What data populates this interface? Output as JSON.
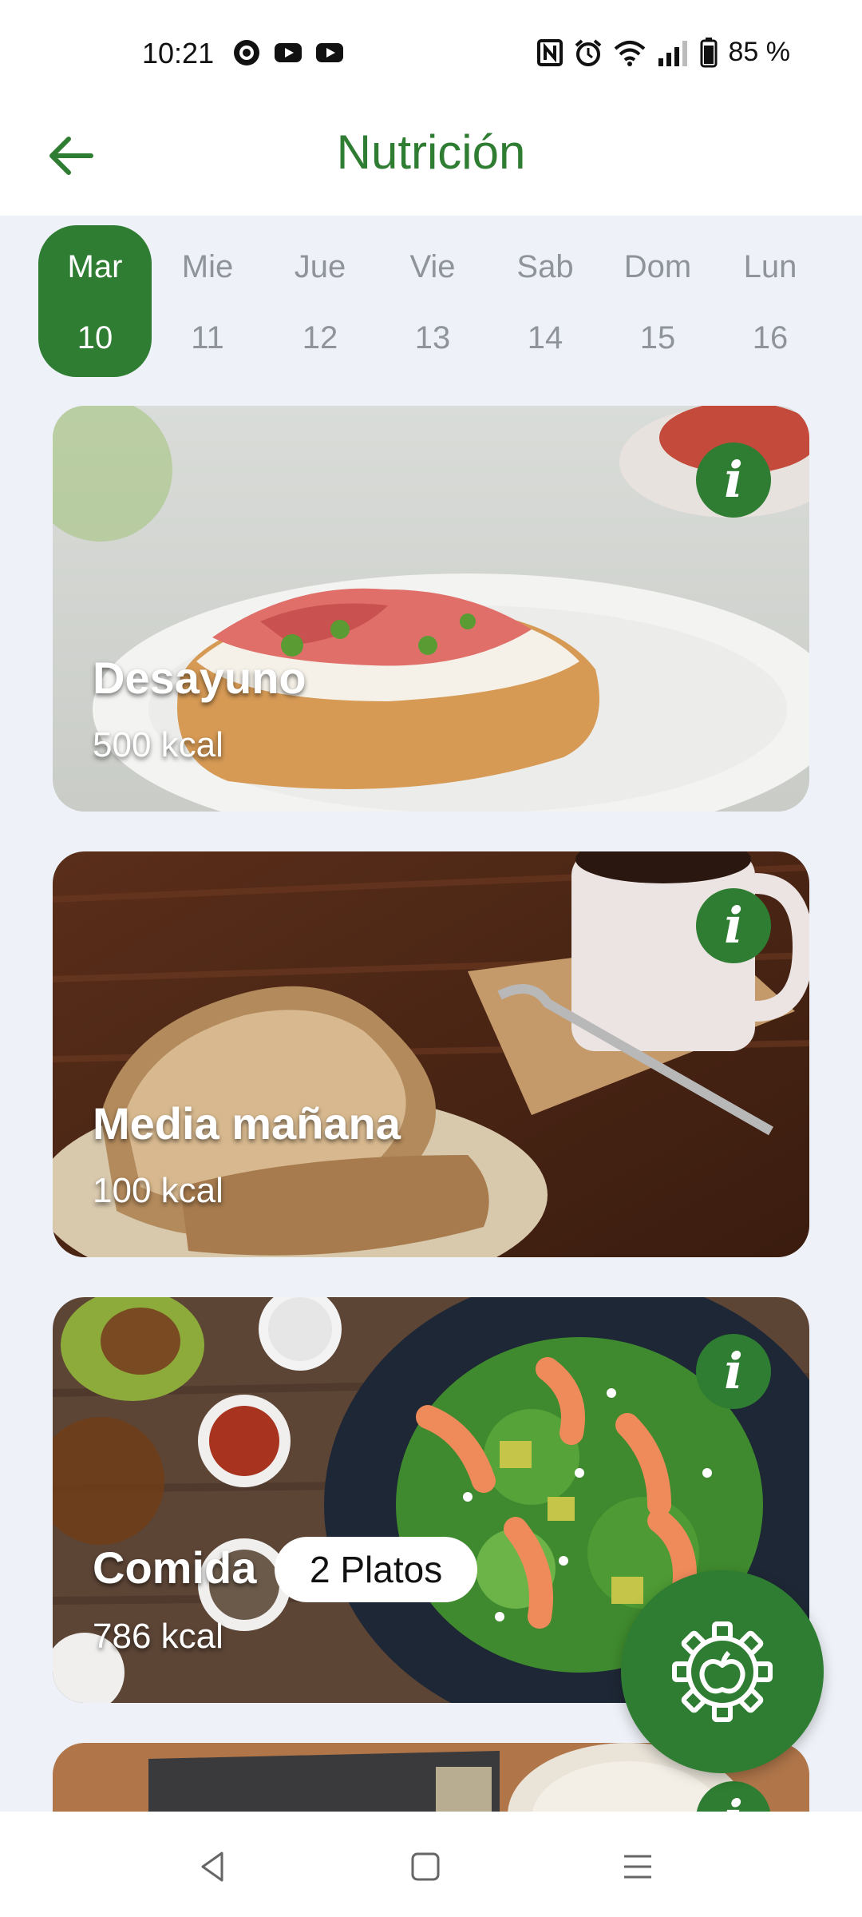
{
  "status_bar": {
    "time": "10:21",
    "battery": "85 %",
    "icons": [
      "record-icon",
      "youtube-icon",
      "youtube-icon",
      "nfc-icon",
      "alarm-icon",
      "wifi-icon",
      "signal-icon",
      "battery-icon"
    ]
  },
  "header": {
    "title": "Nutrición",
    "back_icon": "arrow-left-icon"
  },
  "days": [
    {
      "name": "Mar",
      "num": "10",
      "active": true
    },
    {
      "name": "Mie",
      "num": "11",
      "active": false
    },
    {
      "name": "Jue",
      "num": "12",
      "active": false
    },
    {
      "name": "Vie",
      "num": "13",
      "active": false
    },
    {
      "name": "Sab",
      "num": "14",
      "active": false
    },
    {
      "name": "Dom",
      "num": "15",
      "active": false
    },
    {
      "name": "Lun",
      "num": "16",
      "active": false
    }
  ],
  "meals": [
    {
      "name": "Desayuno",
      "kcal": "500 kcal"
    },
    {
      "name": "Media mañana",
      "kcal": "100 kcal"
    },
    {
      "name": "Comida",
      "kcal": "786 kcal",
      "dishes": "2 Platos"
    }
  ],
  "info_label": "i",
  "colors": {
    "accent": "#2e7d32",
    "background": "#eef2f8"
  },
  "fab_icon": "gear-apple-icon",
  "nav": {
    "icons": [
      "back-triangle-icon",
      "home-square-icon",
      "menu-lines-icon"
    ]
  }
}
